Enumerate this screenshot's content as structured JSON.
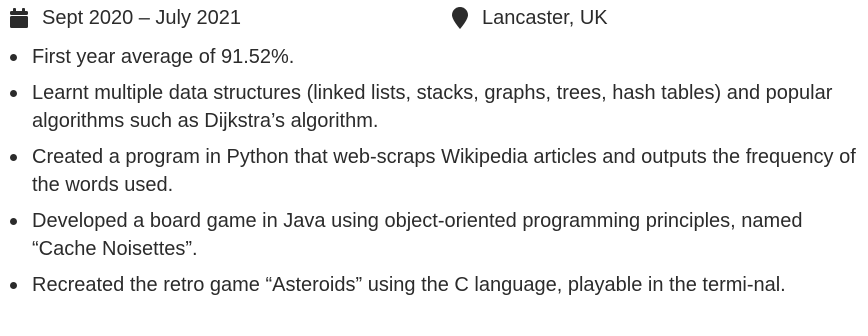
{
  "meta": {
    "date_icon": "calendar-icon",
    "date_range": "Sept 2020 – July 2021",
    "location_icon": "map-marker-icon",
    "location": "Lancaster, UK"
  },
  "bullets": [
    "First year average of 91.52%.",
    "Learnt multiple data structures (linked lists, stacks, graphs, trees, hash tables) and popular algorithms such as Dijkstra’s algorithm.",
    "Created a program in Python that web-scraps Wikipedia articles and outputs the frequency of the words used.",
    "Developed a board game in Java using object-oriented programming principles, named “Cache Noisettes”.",
    "Recreated the retro game “Asteroids” using the C language, playable in the termi-nal."
  ]
}
